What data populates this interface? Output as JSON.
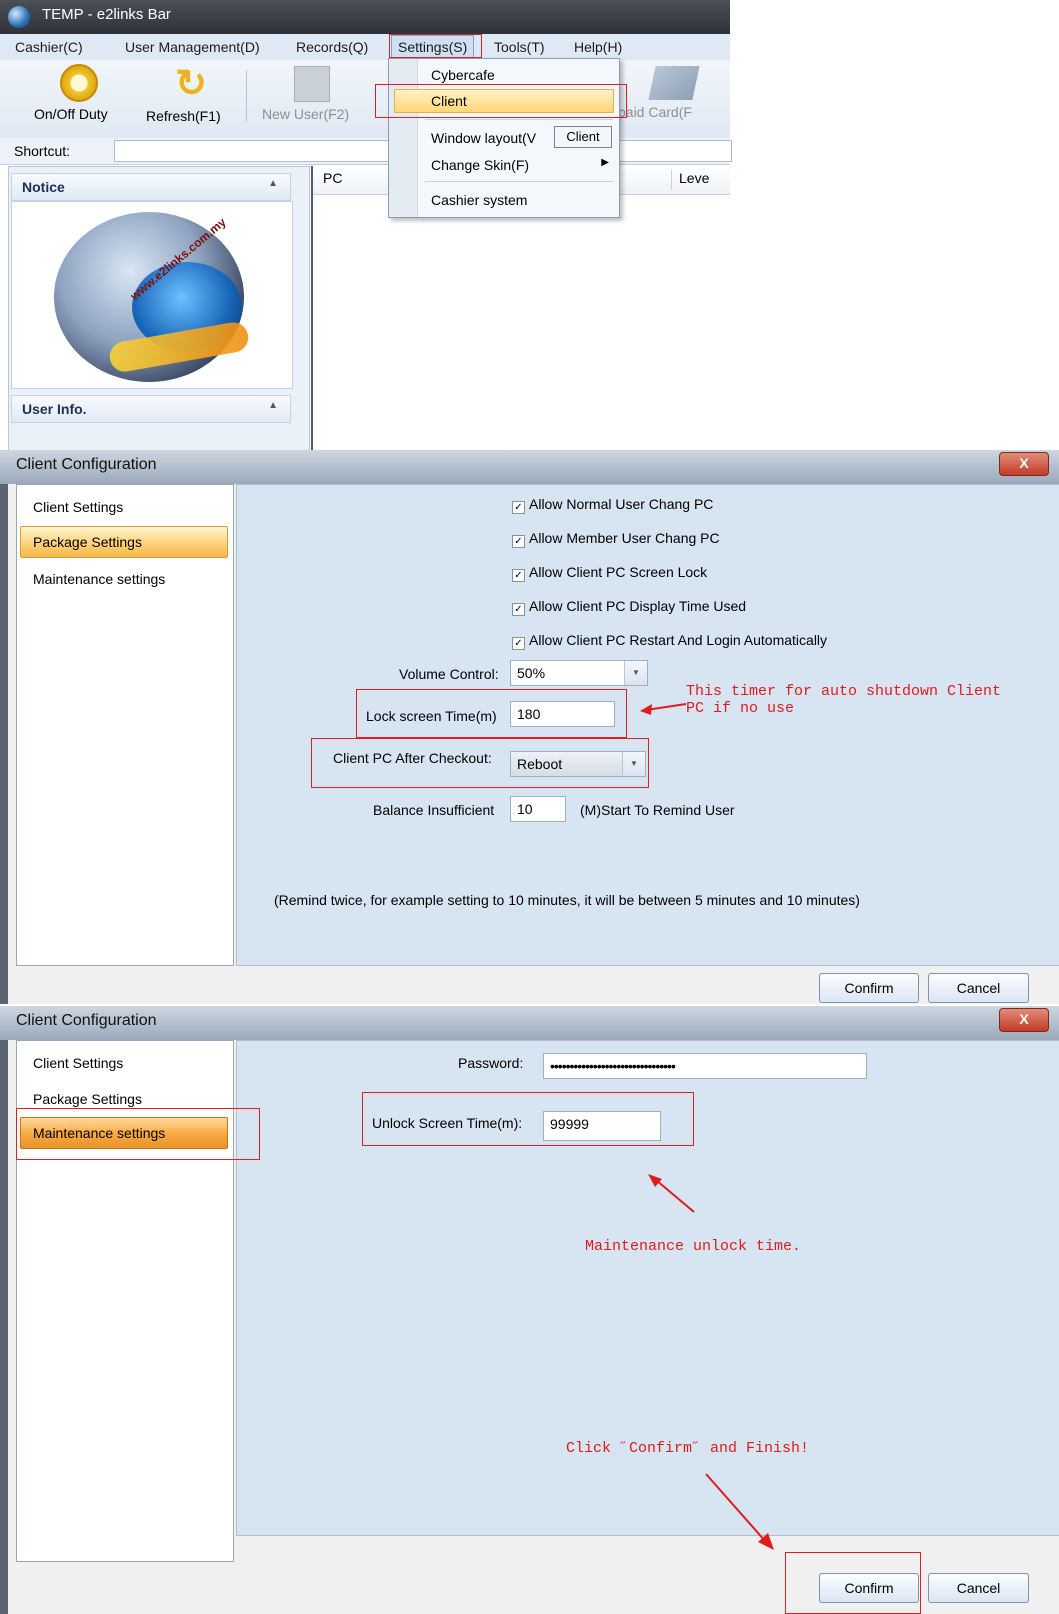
{
  "app": {
    "title": "TEMP - e2links Bar",
    "menu": [
      "Cashier(C)",
      "User Management(D)",
      "Records(Q)",
      "Settings(S)",
      "Tools(T)",
      "Help(H)"
    ],
    "toolbar": {
      "onoff_duty": "On/Off Duty",
      "refresh": "Refresh(F1)",
      "new_user": "New User(F2)",
      "prepaid_card": "paid Card(F"
    },
    "shortcut_label": "Shortcut:",
    "notice_header": "Notice",
    "logo_text": "www.e2links.com.my",
    "user_info_header": "User Info.",
    "grid_columns": [
      "PC",
      "Leve"
    ]
  },
  "settings_menu": {
    "items": [
      "Cybercafe",
      "Client",
      "Window layout(V",
      "Change Skin(F)",
      "Cashier system"
    ],
    "tooltip": "Client"
  },
  "dialog1": {
    "title": "Client Configuration",
    "close": "X",
    "nav": [
      "Client Settings",
      "Package Settings",
      "Maintenance settings"
    ],
    "selected_nav": "Package Settings",
    "checkboxes": [
      {
        "label": "Allow Normal User Chang PC",
        "checked": true
      },
      {
        "label": "Allow Member User Chang PC",
        "checked": true
      },
      {
        "label": "Allow Client PC Screen Lock",
        "checked": true
      },
      {
        "label": "Allow Client PC Display Time Used",
        "checked": true
      },
      {
        "label": "Allow Client PC Restart And Login Automatically",
        "checked": true
      }
    ],
    "volume_label": "Volume Control:",
    "volume_value": "50%",
    "lock_label": "Lock screen Time(m)",
    "lock_value": "180",
    "checkout_label": "Client PC After Checkout:",
    "checkout_value": "Reboot",
    "balance_label": "Balance Insufficient",
    "balance_value": "10",
    "balance_suffix": "(M)Start To Remind User",
    "remind_note": "(Remind twice, for example setting to 10 minutes, it will be between 5 minutes and 10 minutes)",
    "annotation": "This timer for auto shutdown Client\nPC if no use",
    "confirm": "Confirm",
    "cancel": "Cancel"
  },
  "dialog2": {
    "title": "Client Configuration",
    "close": "X",
    "nav": [
      "Client Settings",
      "Package Settings",
      "Maintenance settings"
    ],
    "selected_nav": "Maintenance settings",
    "password_label": "Password:",
    "password_value": "••••••••••••••••••••••••••••••••",
    "unlock_label": "Unlock Screen Time(m):",
    "unlock_value": "99999",
    "annotation_unlock": "Maintenance unlock time.",
    "annotation_confirm": "Click ˝Confirm˝ and Finish!",
    "confirm": "Confirm",
    "cancel": "Cancel"
  },
  "colors": {
    "highlight_red": "#e02020",
    "content_bg": "#d7e4f1",
    "selected_nav": "#ffd27a"
  }
}
